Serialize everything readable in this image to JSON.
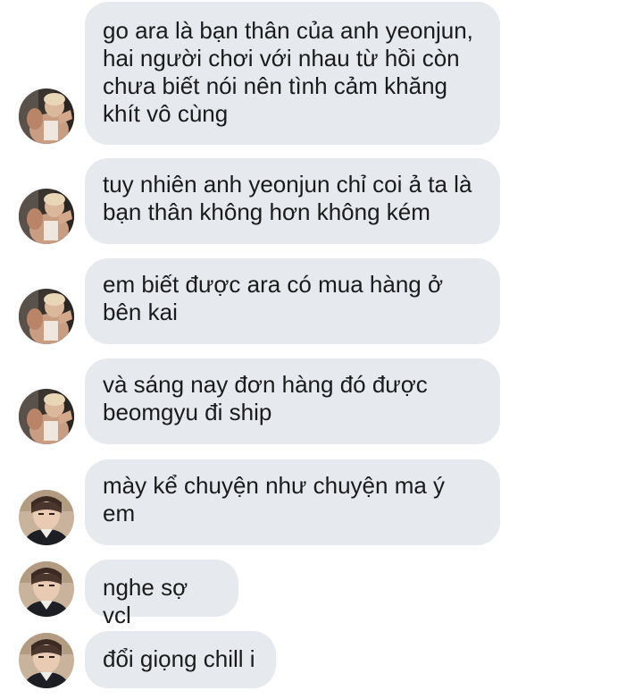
{
  "messages": [
    {
      "sender": "A",
      "text": "go ara là bạn thân của anh yeonjun,\nhai người chơi với nhau từ hồi còn\nchưa biết nói nên tình cảm khăng\nkhít vô cùng"
    },
    {
      "sender": "A",
      "text": "tuy nhiên anh yeonjun chỉ coi ả ta là\nbạn thân không hơn không kém"
    },
    {
      "sender": "A",
      "text": "em biết được ara có mua hàng ở\nbên kai"
    },
    {
      "sender": "A",
      "text": "và sáng nay đơn hàng đó được\nbeomgyu đi ship"
    },
    {
      "sender": "B",
      "text": "mày kể chuyện như chuyện ma ý\nem"
    },
    {
      "sender": "B",
      "text": "nghe sợ vcl"
    },
    {
      "sender": "B",
      "text": "đổi giọng chill i"
    }
  ],
  "colors": {
    "bubble": "#e6e9ed",
    "text": "#1b1b1b",
    "background": "#ffffff"
  }
}
